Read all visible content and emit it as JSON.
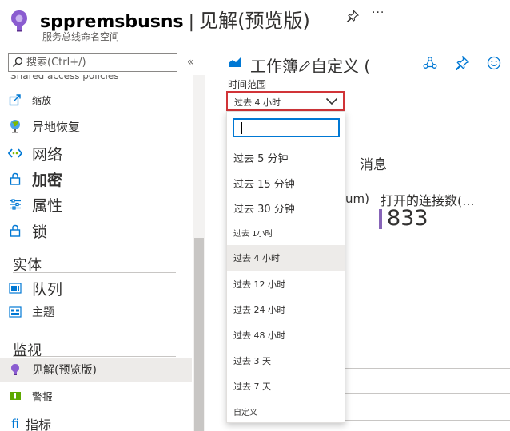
{
  "header": {
    "resource_name": "sppremsbusns",
    "separator": "|",
    "page_title": "见解(预览版)",
    "subtitle": "服务总线命名空间",
    "more": "···"
  },
  "sidebar": {
    "search_placeholder": "搜索(Ctrl+/)",
    "collapse_glyph": "«",
    "partial_item": "Shared access policies",
    "items": [
      {
        "label": "缩放",
        "icon": "scale-icon"
      },
      {
        "label": "异地恢复",
        "icon": "globe-icon"
      },
      {
        "label": "网络",
        "icon": "network-icon"
      },
      {
        "label": "加密",
        "icon": "lock-icon"
      },
      {
        "label": "属性",
        "icon": "properties-icon"
      },
      {
        "label": "锁",
        "icon": "lock-icon"
      }
    ],
    "section_entities": "实体",
    "entity_items": [
      {
        "label": "队列",
        "icon": "queue-icon"
      },
      {
        "label": "主题",
        "icon": "topic-icon"
      }
    ],
    "section_monitoring": "监视",
    "monitor_items": [
      {
        "label": "见解(预览版)",
        "icon": "insights-icon",
        "selected": true
      },
      {
        "label": "警报",
        "icon": "alert-icon"
      },
      {
        "label": "指标",
        "icon": "metrics-icon"
      }
    ]
  },
  "workbook": {
    "title": "工作簿",
    "title_suffix": "自定义 (",
    "time_range_label": "时间范围",
    "time_range_value": "过去 4 小时",
    "messages_label": "消息",
    "um_label": "um)",
    "open_connections_label": "打开的连接数(...",
    "open_connections_value": "833"
  },
  "dropdown": {
    "search_value": "",
    "selected_index": 4,
    "options": [
      "过去 5 分钟",
      "过去 15 分钟",
      "过去 30 分钟",
      "过去 1小时",
      "过去 4 小时",
      "过去 12 小时",
      "过去 24 小时",
      "过去 48 小时",
      "过去 3 天",
      "过去 7 天",
      "自定义"
    ]
  },
  "colors": {
    "accent": "#0078d4",
    "highlight_border": "#d13438",
    "bar": "#8764b8",
    "selected_bg": "#edebe9"
  }
}
